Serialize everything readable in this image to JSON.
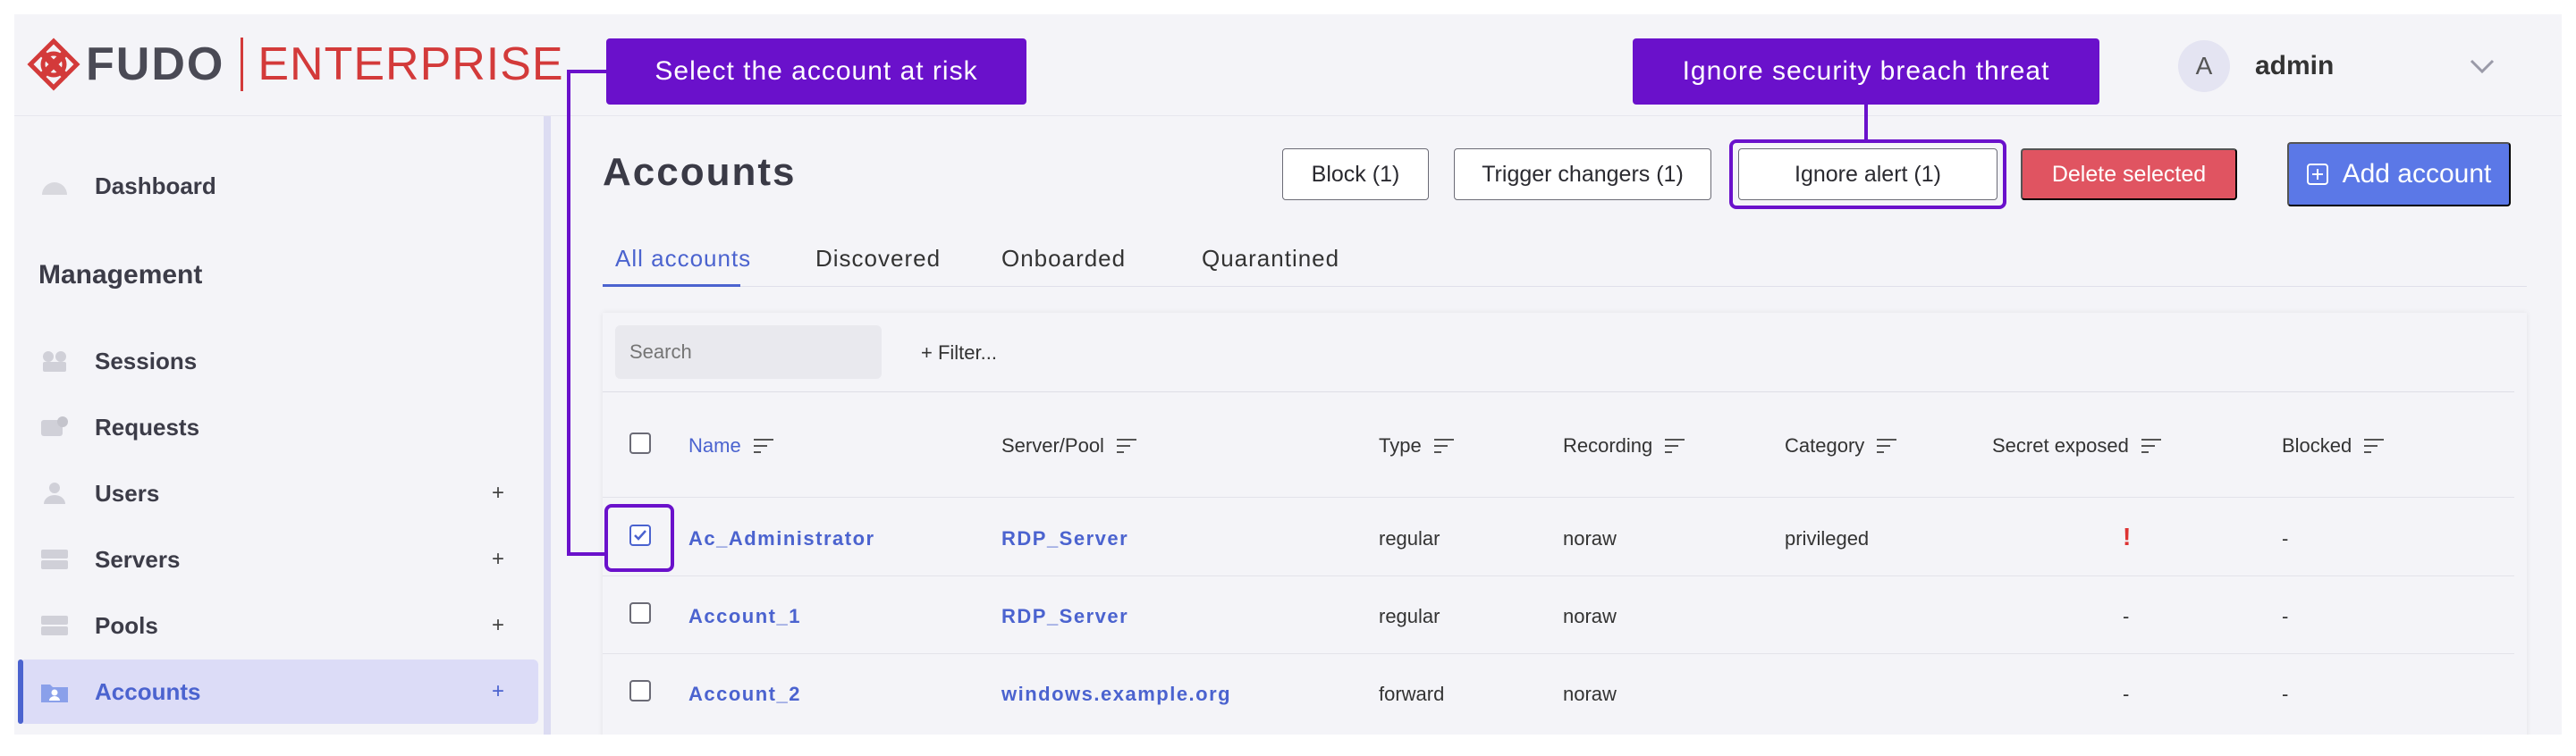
{
  "brand": {
    "name": "FUDO",
    "edition": "ENTERPRISE",
    "accent": "#d33a3a"
  },
  "user": {
    "initial": "A",
    "name": "admin"
  },
  "sidebar": {
    "top_item": "Dashboard",
    "section": "Management",
    "items": [
      {
        "label": "Sessions",
        "icon": "sessions-icon",
        "plus": ""
      },
      {
        "label": "Requests",
        "icon": "requests-icon",
        "plus": ""
      },
      {
        "label": "Users",
        "icon": "users-icon",
        "plus": "+"
      },
      {
        "label": "Servers",
        "icon": "servers-icon",
        "plus": "+"
      },
      {
        "label": "Pools",
        "icon": "pools-icon",
        "plus": "+"
      },
      {
        "label": "Accounts",
        "icon": "accounts-icon",
        "plus": "+",
        "active": true
      }
    ]
  },
  "page": {
    "title": "Accounts"
  },
  "toolbar": {
    "block": "Block (1)",
    "trigger": "Trigger changers (1)",
    "ignore": "Ignore alert (1)",
    "delete": "Delete selected",
    "add": "Add account"
  },
  "tabs": [
    "All accounts",
    "Discovered",
    "Onboarded",
    "Quarantined"
  ],
  "filter_bar": {
    "search_placeholder": "Search",
    "filter_label": "+ Filter..."
  },
  "table": {
    "columns": [
      "Name",
      "Server/Pool",
      "Type",
      "Recording",
      "Category",
      "Secret exposed",
      "Blocked"
    ],
    "rows": [
      {
        "checked": true,
        "name": "Ac_Administrator",
        "server": "RDP_Server",
        "type": "regular",
        "recording": "noraw",
        "category": "privileged",
        "secret": "!",
        "blocked": "-"
      },
      {
        "checked": false,
        "name": "Account_1",
        "server": "RDP_Server",
        "type": "regular",
        "recording": "noraw",
        "category": "",
        "secret": "-",
        "blocked": "-"
      },
      {
        "checked": false,
        "name": "Account_2",
        "server": "windows.example.org",
        "type": "forward",
        "recording": "noraw",
        "category": "",
        "secret": "-",
        "blocked": "-"
      }
    ]
  },
  "callouts": {
    "select": "Select the account at risk",
    "ignore": "Ignore security breach threat"
  },
  "colors": {
    "primary": "#5b78e7",
    "danger": "#e05461",
    "callout": "#6a11cb",
    "link": "#4b63cf"
  }
}
